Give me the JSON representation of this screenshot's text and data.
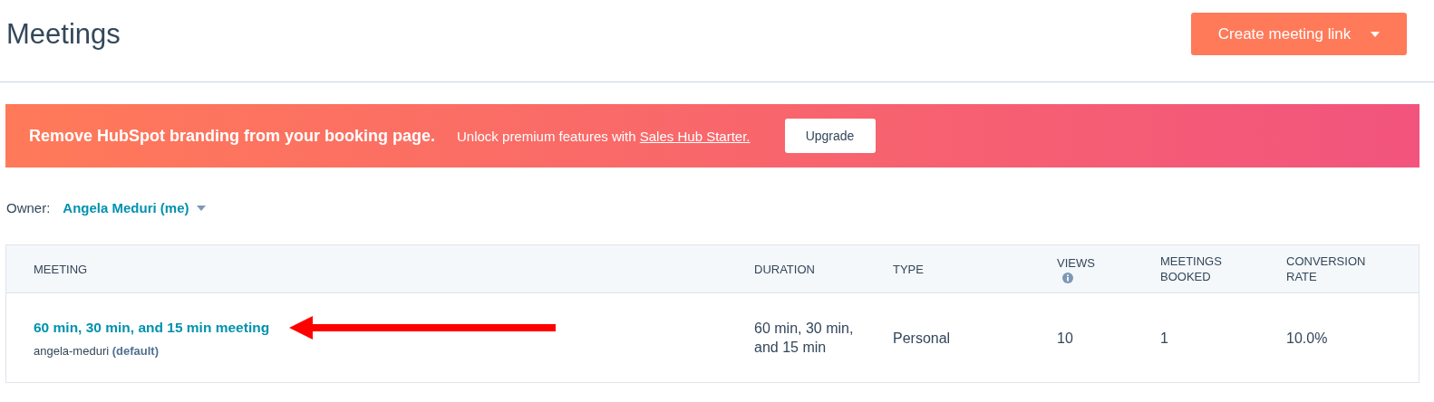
{
  "page": {
    "title": "Meetings"
  },
  "create_button": {
    "label": "Create meeting link"
  },
  "banner": {
    "headline": "Remove HubSpot branding from your booking page.",
    "text": "Unlock premium features with",
    "link": "Sales Hub Starter.",
    "button": "Upgrade"
  },
  "owner_filter": {
    "label": "Owner:",
    "value": "Angela Meduri (me)"
  },
  "table": {
    "columns": [
      {
        "label": "MEETING"
      },
      {
        "label": "DURATION"
      },
      {
        "label": "TYPE"
      },
      {
        "label": "VIEWS",
        "info": true
      },
      {
        "label": "MEETINGS BOOKED"
      },
      {
        "label": "CONVERSION RATE"
      }
    ],
    "rows": [
      {
        "name": "60 min, 30 min, and 15 min meeting",
        "slug": "angela-meduri",
        "tag": "(default)",
        "duration": "60 min, 30 min, and 15 min",
        "type": "Personal",
        "views": "10",
        "booked": "1",
        "conversion": "10.0%"
      }
    ]
  }
}
